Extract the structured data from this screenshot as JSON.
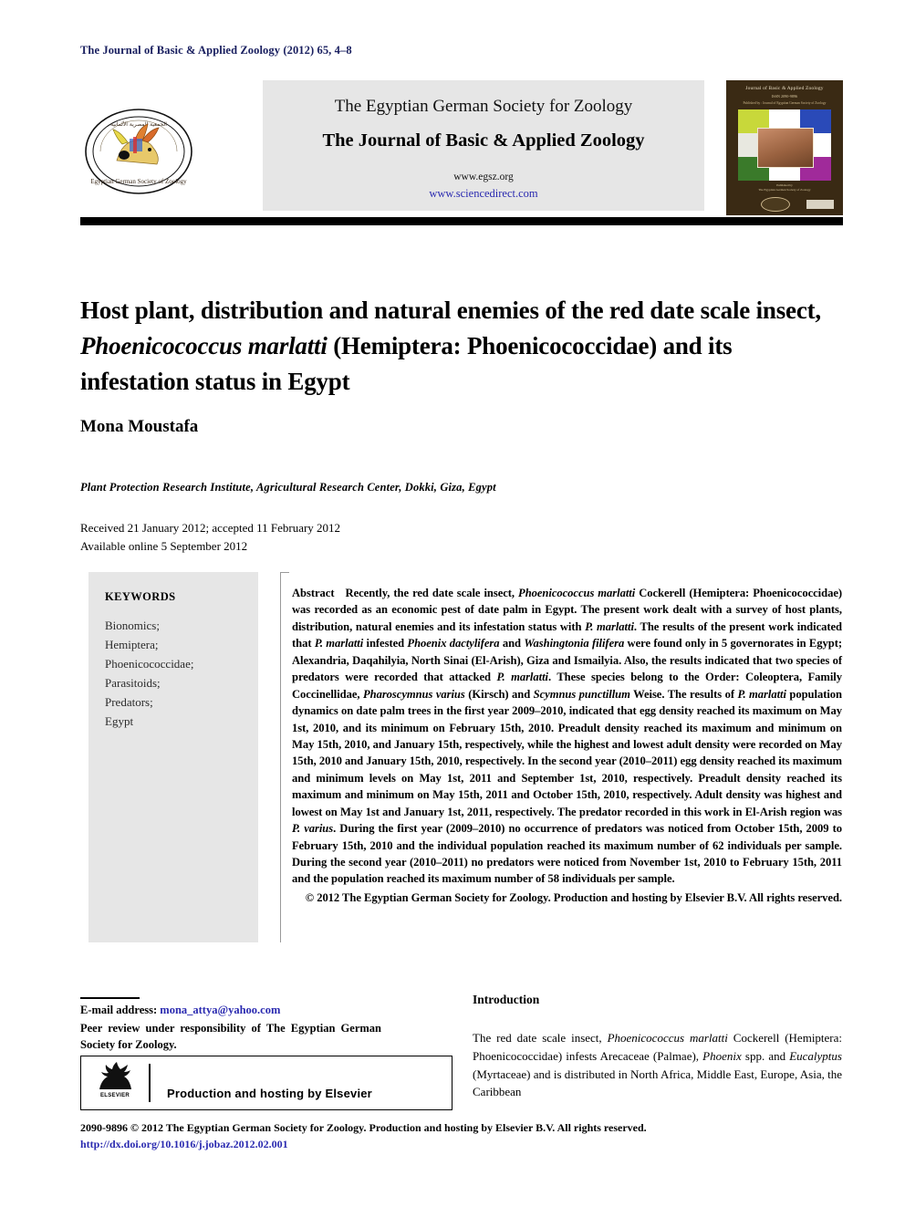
{
  "running_head": "The Journal of Basic & Applied Zoology (2012) 65, 4–8",
  "masthead": {
    "society_logo_alt": "society-seal-icon",
    "society_name": "The Egyptian German Society for Zoology",
    "journal_name": "The Journal of Basic & Applied Zoology",
    "url_society": "www.egsz.org",
    "url_sciencedirect": "www.sciencedirect.com",
    "cover": {
      "title": "Journal of Basic & Applied Zoology",
      "issn": "ISSN 2090-9896",
      "subtitle": "Published by : Journal of Egyptian German Society of Zoology",
      "publisher_line": "Published by\nThe Egyptian German Society of Zoology\nwww.egsz.org\nwww.elsevier.com"
    }
  },
  "article": {
    "title_part1": "Host plant, distribution and natural enemies of the red date scale insect, ",
    "title_species": "Phoenicococcus marlatti",
    "title_part2": " (Hemiptera: Phoenicococcidae) and its infestation status in Egypt",
    "author": "Mona Moustafa",
    "affiliation": "Plant Protection Research Institute, Agricultural Research Center, Dokki, Giza, Egypt",
    "received": "Received 21 January 2012; accepted 11 February 2012",
    "available_online": "Available online 5 September 2012"
  },
  "keywords": {
    "heading": "KEYWORDS",
    "items": [
      "Bionomics;",
      "Hemiptera;",
      "Phoenicococcidae;",
      "Parasitoids;",
      "Predators;",
      "Egypt"
    ]
  },
  "abstract": {
    "label": "Abstract",
    "body_1": "Recently, the red date scale insect, ",
    "sp_1": "Phoenicococcus marlatti",
    "body_2": " Cockerell (Hemiptera: Phoenicococcidae) was recorded as an economic pest of date palm in Egypt. The present work dealt with a survey of host plants, distribution, natural enemies and its infestation status with ",
    "sp_2": "P. marlatti",
    "body_3": ". The results of the present work indicated that ",
    "sp_3": "P. marlatti",
    "body_4": " infested ",
    "sp_4": "Phoenix dactylifera",
    "body_5": " and ",
    "sp_5": "Washingtonia filifera",
    "body_6": " were found only in 5 governorates in Egypt; Alexandria, Daqahilyia, North Sinai (El-Arish), Giza and Ismailyia. Also, the results indicated that two species of predators were recorded that attacked ",
    "sp_6": "P. marlatti",
    "body_7": ". These species belong to the Order: Coleoptera, Family Coccinellidae, ",
    "sp_7": "Pharoscymnus varius",
    "body_8": " (Kirsch) and ",
    "sp_8": "Scymnus punctillum",
    "body_9": " Weise. The results of ",
    "sp_9": "P. marlatti",
    "body_10": " population dynamics on date palm trees in the first year 2009–2010, indicated that egg density reached its maximum on May 1st, 2010, and its minimum on February 15th, 2010. Preadult density reached its maximum and minimum on May 15th, 2010, and January 15th, respectively, while the highest and lowest adult density were recorded on May 15th, 2010 and January 15th, 2010, respectively. In the second year (2010–2011) egg density reached its maximum and minimum levels on May 1st, 2011 and September 1st, 2010, respectively. Preadult density reached its maximum and minimum on May 15th, 2011 and October 15th, 2010, respectively. Adult density was highest and lowest on May 1st and January 1st, 2011, respectively. The predator recorded in this work in El-Arish region was ",
    "sp_10": "P. varius",
    "body_11": ". During the first year (2009–2010) no occurrence of predators was noticed from October 15th, 2009 to February 15th, 2010 and the individual population reached its maximum number of 62 individuals per sample. During the second year (2010–2011) no predators were noticed from November 1st, 2010 to February 15th, 2011 and the population reached its maximum number of 58 individuals per sample.",
    "copyright": "© 2012 The Egyptian German Society for Zoology. Production and hosting by Elsevier B.V. All rights reserved."
  },
  "footnote": {
    "email_label": "E-mail address:",
    "email": "mona_attya@yahoo.com",
    "peer_review": "Peer review under responsibility of The Egyptian German Society for Zoology."
  },
  "elsevier_box": {
    "logo_word": "ELSEVIER",
    "text": "Production and hosting by Elsevier"
  },
  "introduction": {
    "heading": "Introduction",
    "body_1": "The red date scale insect, ",
    "sp_1": "Phoenicococcus marlatti",
    "body_2": " Cockerell (Hemiptera: Phoenicococcidae) infests Arecaceae (Palmae), ",
    "sp_2": "Phoenix",
    "body_3": " spp. and ",
    "sp_3": "Eucalyptus",
    "body_4": " (Myrtaceae) and is distributed in North Africa, Middle East, Europe, Asia, the Caribbean"
  },
  "footer": {
    "issn_line": "2090-9896 © 2012 The Egyptian German Society for Zoology. Production and hosting by Elsevier B.V. All rights reserved.",
    "doi": "http://dx.doi.org/10.1016/j.jobaz.2012.02.001"
  },
  "colors": {
    "running_head": "#1a2060",
    "link_blue": "#2a2ab0",
    "banner_bg": "#e6e6e6",
    "cover_bg": "#3a2a14"
  }
}
